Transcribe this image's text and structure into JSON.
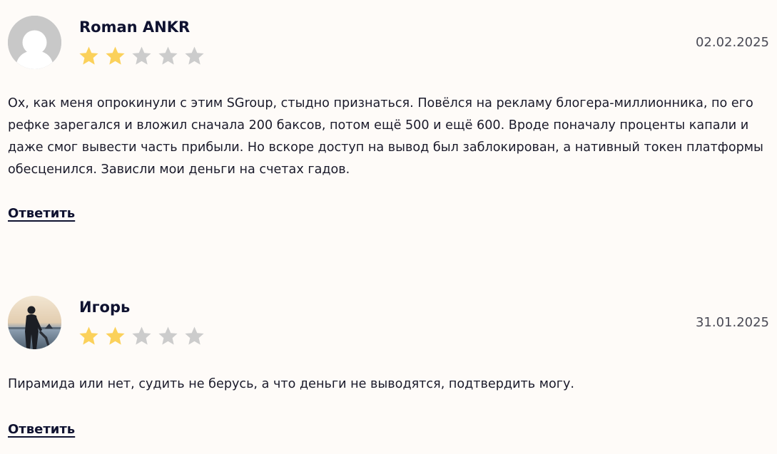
{
  "reviews": [
    {
      "author": "Roman ANKR",
      "date": "02.02.2025",
      "rating": 2,
      "max_rating": 5,
      "avatar": "default-user-icon",
      "text": "Ох, как меня опрокинули с этим SGroup, стыдно признаться. Повёлся на рекламу блогера-миллионника, по его рефке зарегался и вложил сначала 200 баксов, потом ещё 500 и ещё 600. Вроде поначалу проценты капали и даже смог вывести часть прибыли. Но вскоре доступ на вывод был заблокирован, а нативный токен платформы обесценился. Зависли мои деньги на счетах гадов.",
      "reply_label": "Ответить"
    },
    {
      "author": "Игорь",
      "date": "31.01.2025",
      "rating": 2,
      "max_rating": 5,
      "avatar": "user-photo",
      "text": "Пирамида или нет, судить не берусь, а что деньги не выводятся, подтвердить могу.",
      "reply_label": "Ответить"
    }
  ],
  "colors": {
    "star_filled": "#fbd15b",
    "star_empty": "#cccccc",
    "background": "#fefbf8"
  }
}
